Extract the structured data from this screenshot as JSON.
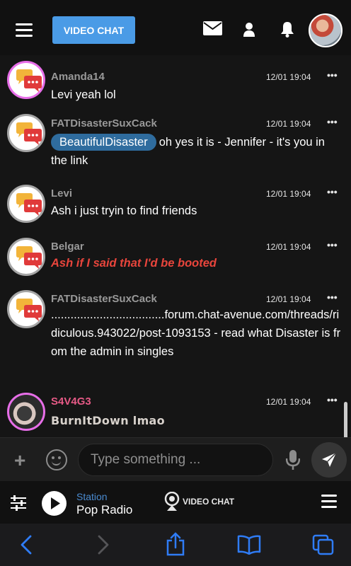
{
  "header": {
    "video_chat_label": "VIDEO CHAT"
  },
  "messages": [
    {
      "name": "Amanda14",
      "time": "12/01 19:04",
      "text": "Levi yeah lol",
      "avatar_ring": "#e76ee8",
      "style": "normal"
    },
    {
      "name": "FATDisasterSuxCack",
      "time": "12/01 19:04",
      "mention": "BeautifulDisaster",
      "text": "oh yes it is - Jennifer - it's you in the link",
      "avatar_ring": "#a5a5a5",
      "style": "normal"
    },
    {
      "name": "Levi",
      "time": "12/01 19:04",
      "text": "Ash i just tryin to find friends",
      "avatar_ring": "#a5a5a5",
      "style": "normal"
    },
    {
      "name": "Belgar",
      "time": "12/01 19:04",
      "text": "Ash if I said that I'd be booted",
      "avatar_ring": "#a5a5a5",
      "style": "red-italic"
    },
    {
      "name": "FATDisasterSuxCack",
      "time": "12/01 19:04",
      "text": "...................................forum.chat-avenue.com/threads/ridiculous.943022/post-1093153 - read what Disaster is from the admin in singles",
      "avatar_ring": "#a5a5a5",
      "style": "normal"
    },
    {
      "name": "S4V4G3",
      "time": "12/01 19:04",
      "text": "BurnItDown lmao",
      "avatar_ring": "#e76ee8",
      "style": "tan"
    }
  ],
  "message_menu": "•••",
  "composer": {
    "placeholder": "Type something ..."
  },
  "radio": {
    "station_label": "Station",
    "station_name": "Pop Radio",
    "video_chat_label": "VIDEO CHAT"
  },
  "icons": {
    "header": [
      "menu-icon",
      "mail-icon",
      "user-icon",
      "bell-icon"
    ],
    "composer": [
      "plus-icon",
      "emoji-icon",
      "mic-icon",
      "send-icon"
    ],
    "browser": [
      "back-icon",
      "forward-icon",
      "share-icon",
      "bookmarks-icon",
      "tabs-icon"
    ]
  },
  "colors": {
    "accent": "#4a9be6",
    "mention_bg": "#2f6c9e",
    "female_ring": "#e76ee8",
    "male_ring": "#a5a5a5",
    "alert_text": "#e8453c",
    "pink_name": "#e65a86",
    "ios_blue": "#2f7cf6"
  }
}
